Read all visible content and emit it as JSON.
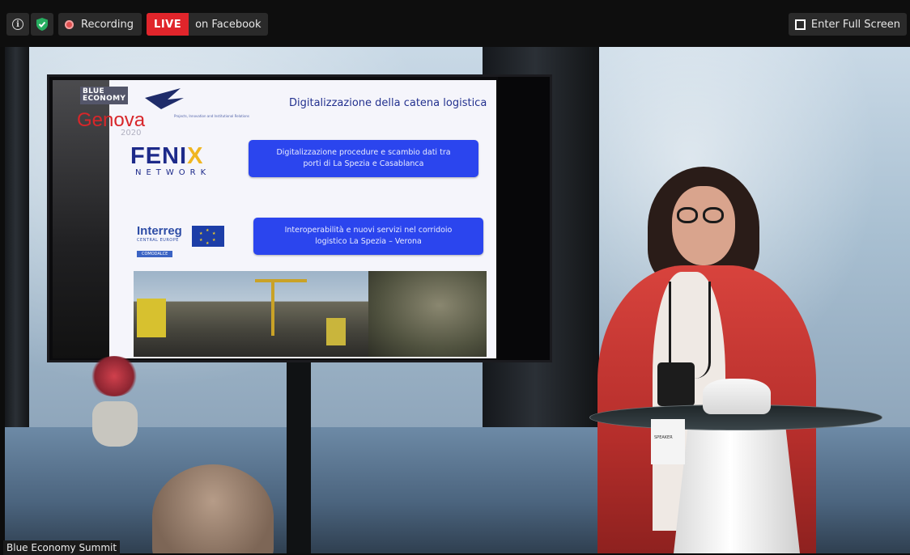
{
  "toolbar": {
    "recording_label": "Recording",
    "live_badge": "LIVE",
    "live_platform": "on Facebook",
    "fullscreen_label": "Enter Full Screen",
    "icons": {
      "info": "info-icon",
      "security": "shield-check-icon",
      "recording": "record-dot-icon",
      "fullscreen": "fullscreen-corners-icon"
    },
    "colors": {
      "live": "#e0252b",
      "security": "#27ae60",
      "record": "#e05050"
    }
  },
  "slide": {
    "title": "Digitalizzazione della catena logistica",
    "logo_event_line1": "BLUE",
    "logo_event_line2": "ECONOMY",
    "logo_city": "Genova",
    "logo_year": "2020",
    "subheader": "Projects, Innovation and Institutional Relations",
    "fenix_main": "FENI",
    "fenix_x": "X",
    "fenix_sub": "NETWORK",
    "box1_line1": "Digitalizzazione procedure e scambio dati tra",
    "box1_line2": "porti di La Spezia e Casablanca",
    "interreg_main": "Interreg",
    "interreg_sub": "CENTRAL EUROPE",
    "interreg_tag": "COMODALCE",
    "box2_line1": "Interoperabilità e nuovi servizi nel corridoio",
    "box2_line2": "logistico La Spezia – Verona"
  },
  "badge_text": "SPEAKER",
  "source_label": "Blue Economy Summit"
}
